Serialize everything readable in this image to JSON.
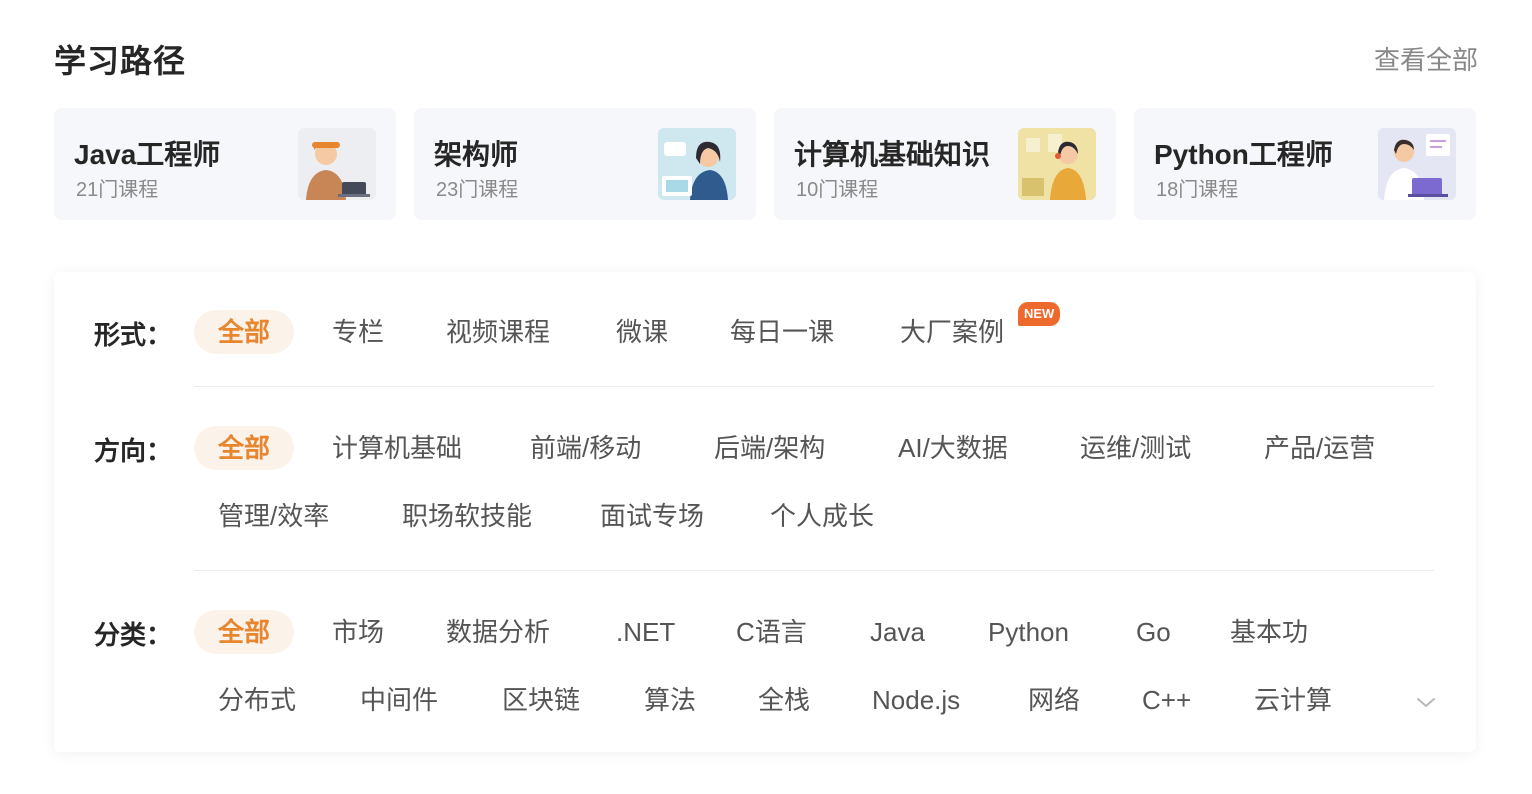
{
  "header": {
    "title": "学习路径",
    "view_all": "查看全部"
  },
  "paths": [
    {
      "title": "Java工程师",
      "count": "21门课程"
    },
    {
      "title": "架构师",
      "count": "23门课程"
    },
    {
      "title": "计算机基础知识",
      "count": "10门课程"
    },
    {
      "title": "Python工程师",
      "count": "18门课程"
    }
  ],
  "filters": {
    "format": {
      "label": "形式：",
      "tags": [
        "全部",
        "专栏",
        "视频课程",
        "微课",
        "每日一课",
        "大厂案例"
      ],
      "new_badge": "NEW"
    },
    "direction": {
      "label": "方向：",
      "tags": [
        "全部",
        "计算机基础",
        "前端/移动",
        "后端/架构",
        "AI/大数据",
        "运维/测试",
        "产品/运营",
        "管理/效率",
        "职场软技能",
        "面试专场",
        "个人成长"
      ]
    },
    "category": {
      "label": "分类：",
      "tags": [
        "全部",
        "市场",
        "数据分析",
        ".NET",
        "C语言",
        "Java",
        "Python",
        "Go",
        "基本功",
        "分布式",
        "中间件",
        "区块链",
        "算法",
        "全栈",
        "Node.js",
        "网络",
        "C++",
        "云计算"
      ]
    }
  },
  "colors": {
    "accent": "#e8852f",
    "accent_bg": "#fbf3ea",
    "badge": "#ee6a2c"
  },
  "icons": {
    "expand": "chevron-down-icon"
  }
}
